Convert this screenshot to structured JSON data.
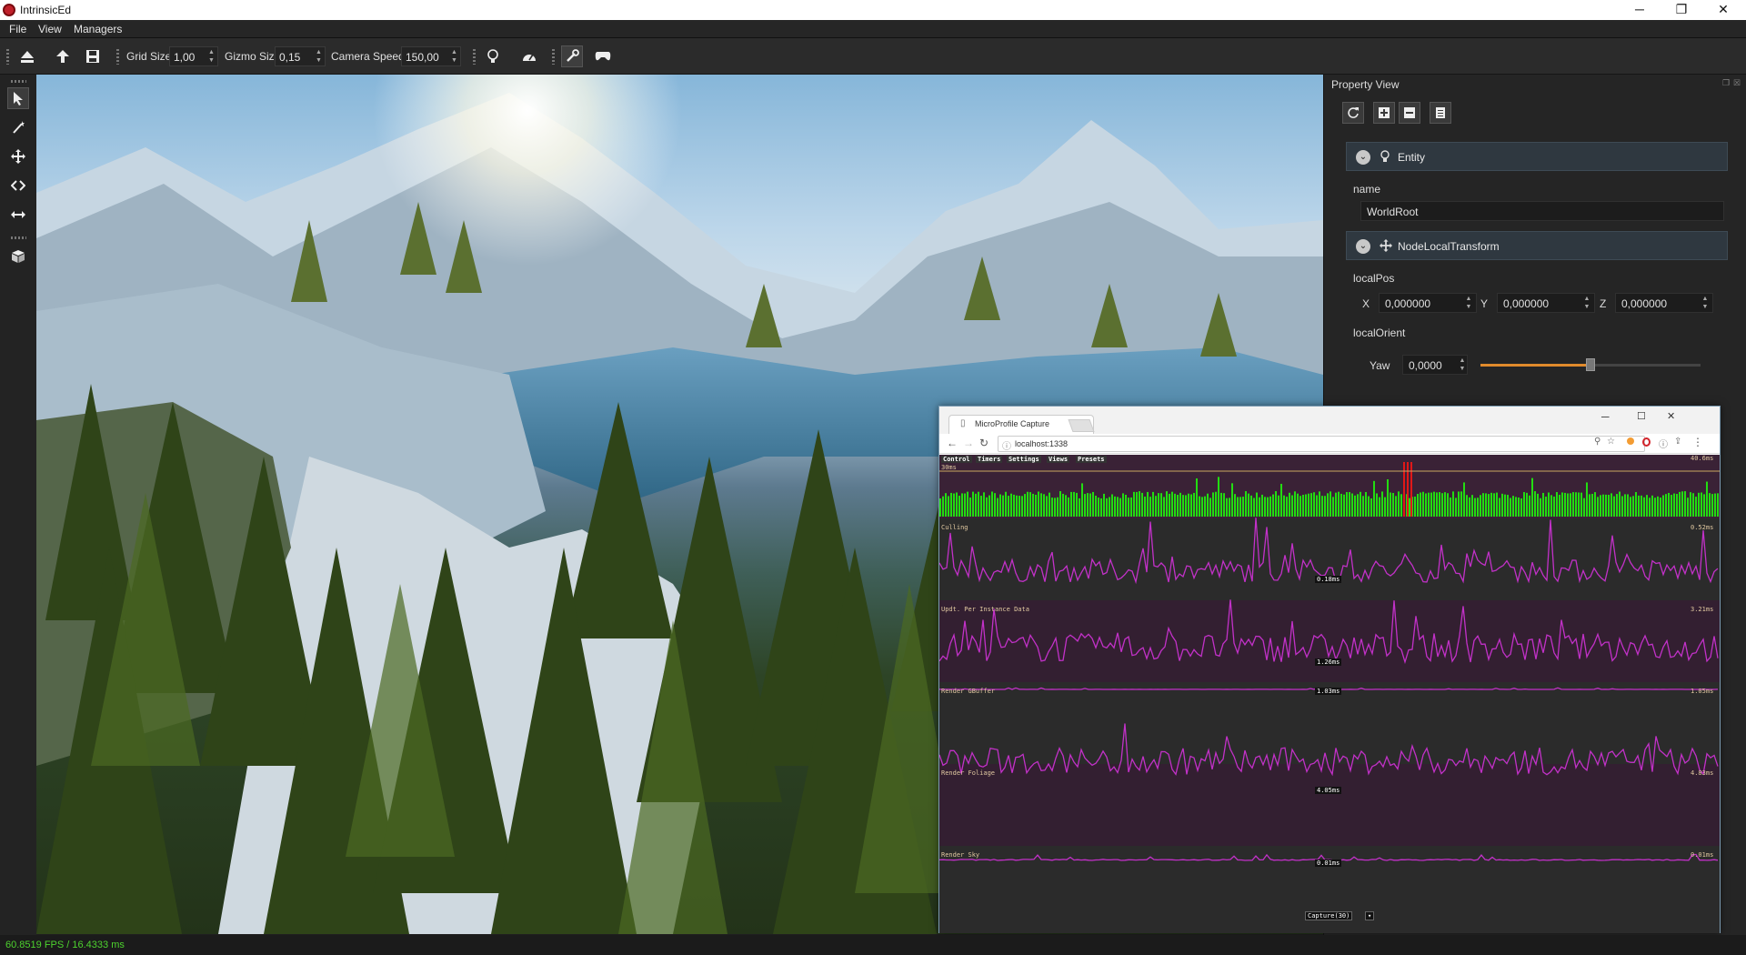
{
  "window": {
    "title": "IntrinsicEd",
    "minimize": "─",
    "restore": "❐",
    "close": "✕"
  },
  "menu": [
    "File",
    "View",
    "Managers"
  ],
  "toolbar": {
    "grid_size_label": "Grid Size",
    "grid_size_value": "1,00",
    "gizmo_size_label": "Gizmo Size",
    "gizmo_size_value": "0,15",
    "camera_speed_label": "Camera Speed",
    "camera_speed_value": "150,00"
  },
  "left_tools": [
    "select-icon",
    "wand-icon",
    "move-icon",
    "code-icon",
    "resize-icon",
    "cube-icon"
  ],
  "property_view": {
    "title": "Property View",
    "entity_section": "Entity",
    "name_label": "name",
    "name_value": "WorldRoot",
    "transform_section": "NodeLocalTransform",
    "local_pos_label": "localPos",
    "x_label": "X",
    "x_value": "0,000000",
    "y_label": "Y",
    "y_value": "0,000000",
    "z_label": "Z",
    "z_value": "0,000000",
    "local_orient_label": "localOrient",
    "yaw_label": "Yaw",
    "yaw_value": "0,0000",
    "yaw_slider_fraction": 0.5
  },
  "browser": {
    "tab_title": "MicroProfile Capture",
    "url": "localhost:1338",
    "menu": [
      "Control",
      "Timers",
      "Settings",
      "Views",
      "Presets"
    ],
    "frame_label": "30ms",
    "frame_max": "40.6ms",
    "tracks": [
      {
        "name": "Culling",
        "max": "0.52ms",
        "avg": "0.18ms"
      },
      {
        "name": "Updt. Per Instance Data",
        "max": "3.21ms",
        "avg": "1.26ms"
      },
      {
        "name": "Render GBuffer",
        "max": "1.05ms",
        "avg": "1.03ms"
      },
      {
        "name": "Render Foliage",
        "max": "4.83ms",
        "avg": "4.05ms"
      },
      {
        "name": "Render Sky",
        "max": "0.01ms",
        "avg": "0.01ms"
      }
    ],
    "capture_button": "Capture(30)"
  },
  "status": {
    "fps": "60.8519 FPS / 16.4333 ms"
  }
}
